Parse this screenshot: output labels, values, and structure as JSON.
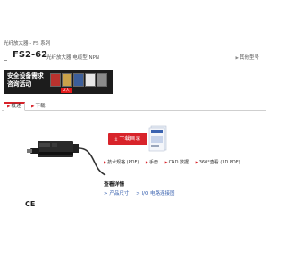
{
  "breadcrumb": "光纤放大器 - FS 系列",
  "product": {
    "model": "FS2-62",
    "description": "光纤放大器 电缆型 NPN",
    "other_models": "其他型号"
  },
  "banner": {
    "line1": "安全设备需求",
    "line2": "咨询活动",
    "badge": "2人",
    "colors": {
      "background": "#1c1c1c",
      "accent": "#e41a1a"
    }
  },
  "tabs": [
    {
      "label": "概述",
      "active": true
    },
    {
      "label": "下载",
      "active": false
    }
  ],
  "download": {
    "button_label": "下载目录",
    "icon": "download-icon"
  },
  "resources": [
    {
      "label": "技术规格 (PDF)"
    },
    {
      "label": "手册"
    },
    {
      "label": "CAD 数据"
    },
    {
      "label": "360°查看 (3D PDF)"
    }
  ],
  "details": {
    "title": "查看详情",
    "links": [
      {
        "label": "> 产品尺寸"
      },
      {
        "label": "> I/O 电路连接图"
      }
    ]
  },
  "ce_mark": "CE",
  "accent_color": "#d8232a"
}
